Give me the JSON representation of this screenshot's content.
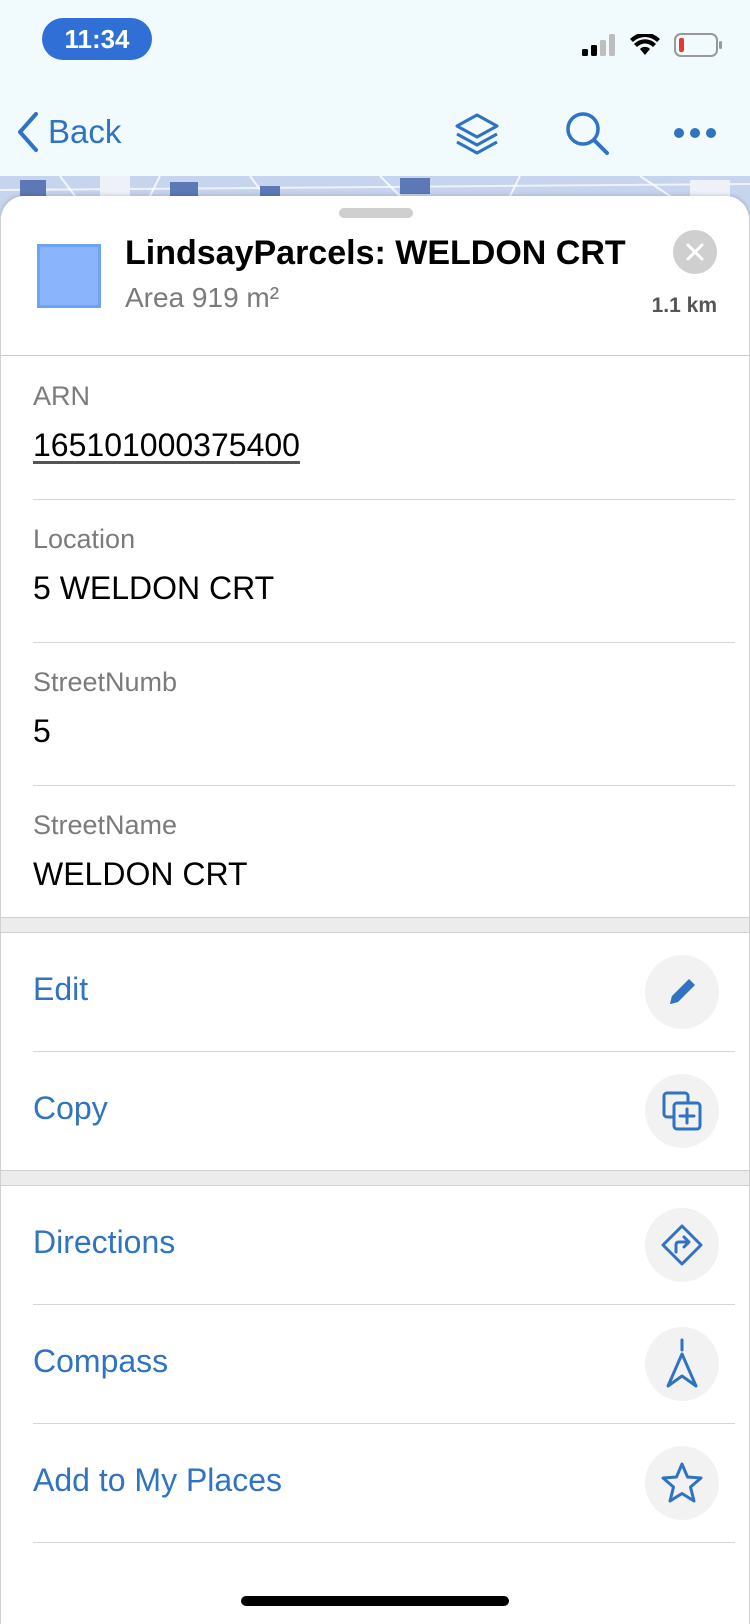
{
  "status_bar": {
    "time": "11:34"
  },
  "nav": {
    "back_label": "Back",
    "icons": [
      "layers-icon",
      "search-icon",
      "more-icon"
    ]
  },
  "feature": {
    "title": "LindsayParcels: WELDON CRT",
    "subtitle": "Area 919 m²",
    "distance": "1.1 km",
    "swatch_color": "#8ab4fb"
  },
  "attributes": [
    {
      "label": "ARN",
      "value": "165101000375400"
    },
    {
      "label": "Location",
      "value": "5 WELDON CRT"
    },
    {
      "label": "StreetNumb",
      "value": "5"
    },
    {
      "label": "StreetName",
      "value": "WELDON CRT"
    }
  ],
  "actions_group1": [
    {
      "label": "Edit",
      "icon": "pencil-icon"
    },
    {
      "label": "Copy",
      "icon": "copy-icon"
    }
  ],
  "actions_group2": [
    {
      "label": "Directions",
      "icon": "directions-icon"
    },
    {
      "label": "Compass",
      "icon": "compass-icon"
    },
    {
      "label": "Add to My Places",
      "icon": "star-icon"
    }
  ],
  "colors": {
    "accent": "#2f73c2",
    "time_pill": "#2f6fd6"
  }
}
